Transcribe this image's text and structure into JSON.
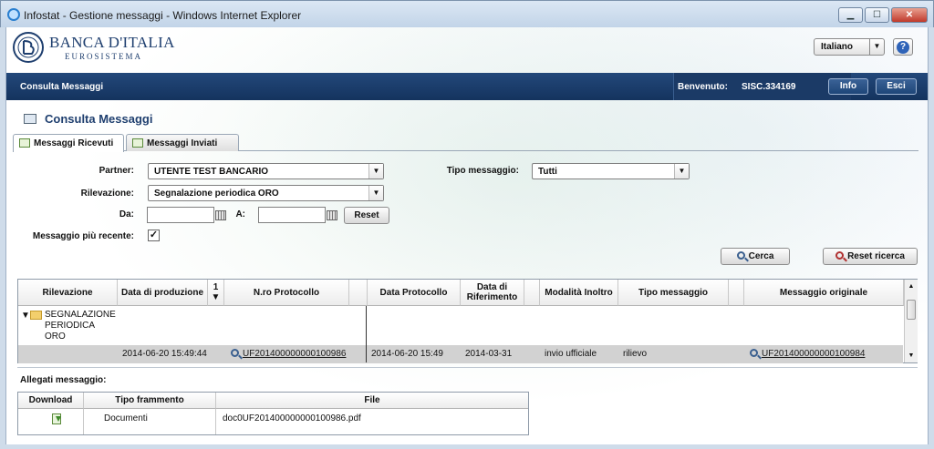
{
  "window": {
    "title": "Infostat - Gestione messaggi - Windows Internet Explorer"
  },
  "header": {
    "bank_name": "BANCA D'ITALIA",
    "bank_sub": "EUROSISTEMA",
    "language": "Italiano",
    "help_icon": "question-icon"
  },
  "navbar": {
    "title": "Consulta Messaggi",
    "welcome_label": "Benvenuto:",
    "user": "SISC.334169",
    "info_label": "Info",
    "exit_label": "Esci"
  },
  "page": {
    "title": "Consulta Messaggi"
  },
  "tabs": [
    {
      "label": "Messaggi Ricevuti",
      "active": true
    },
    {
      "label": "Messaggi Inviati",
      "active": false
    }
  ],
  "filters": {
    "partner_label": "Partner:",
    "partner_value": "UTENTE TEST BANCARIO",
    "rilevazione_label": "Rilevazione:",
    "rilevazione_value": "Segnalazione periodica ORO",
    "da_label": "Da:",
    "a_label": "A:",
    "da_value": "",
    "a_value": "",
    "reset_label": "Reset",
    "recente_label": "Messaggio più recente:",
    "recente_checked": "✓",
    "tipo_label": "Tipo messaggio:",
    "tipo_value": "Tutti"
  },
  "actions": {
    "cerca_label": "Cerca",
    "reset_ricerca_label": "Reset ricerca"
  },
  "grid": {
    "headers": [
      "Rilevazione",
      "Data di produzione",
      "1 ▼",
      "N.ro Protocollo",
      "Data Protocollo",
      "Data di Riferimento",
      "Modalità Inoltro",
      "Tipo messaggio",
      "Messaggio originale"
    ],
    "group_label": "SEGNALAZIONE PERIODICA ORO",
    "row": {
      "data_produzione": "2014-06-20 15:49:44",
      "protocollo": "UF201400000000100986",
      "data_protocollo": "2014-06-20 15:49",
      "data_riferimento": "2014-03-31",
      "modalita": "invio ufficiale",
      "tipo": "rilievo",
      "originale": "UF201400000000100984"
    }
  },
  "attachments": {
    "title": "Allegati messaggio:",
    "headers": [
      "Download",
      "Tipo frammento",
      "File"
    ],
    "rows": [
      {
        "tipo": "Documenti",
        "file": "doc0UF201400000000100986.pdf"
      }
    ]
  }
}
